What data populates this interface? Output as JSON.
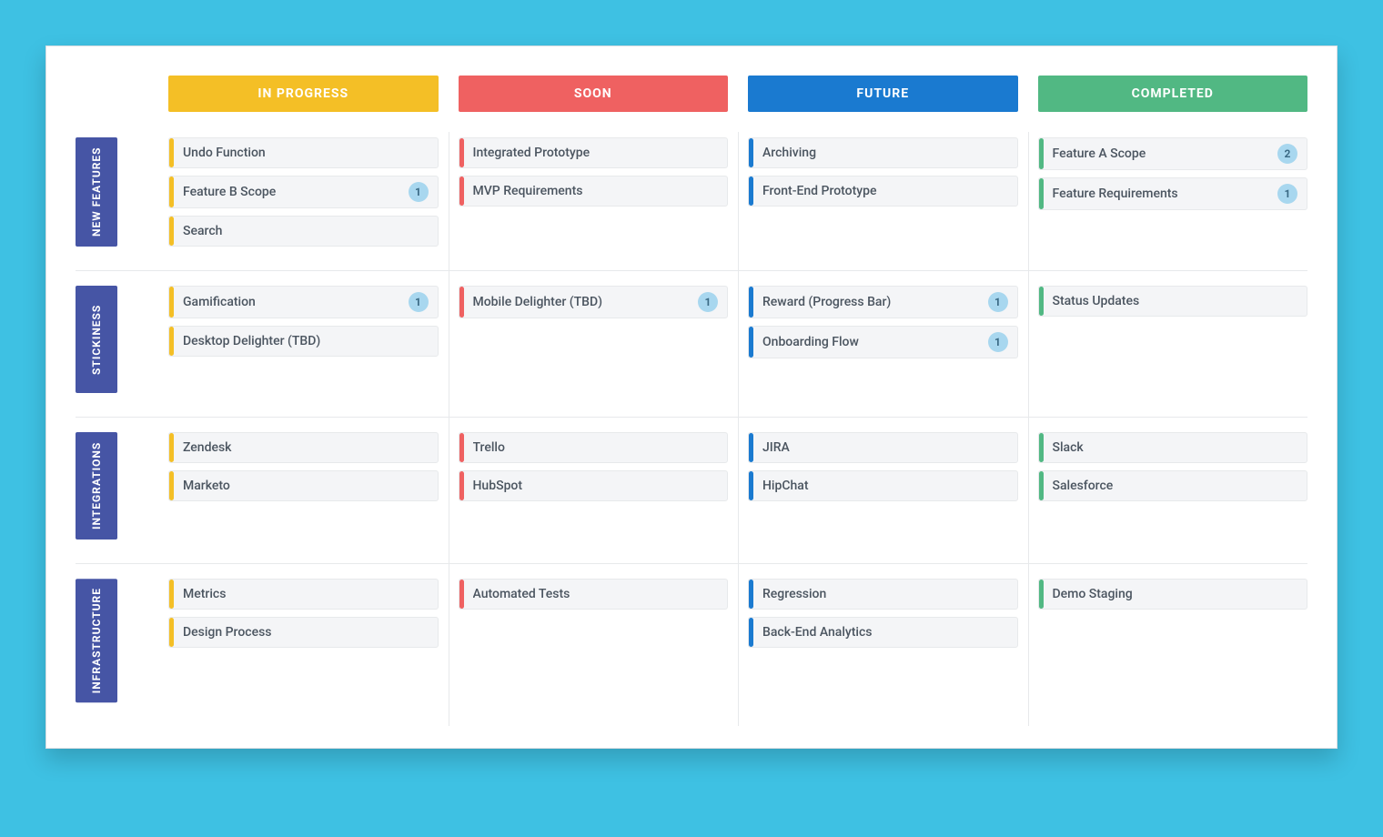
{
  "colors": {
    "in_progress": "#f4bf26",
    "soon": "#ef6161",
    "future": "#1a7ad0",
    "completed": "#51b883",
    "swimlane": "#4655a5",
    "badge_bg": "#a8d7ef"
  },
  "columns": [
    {
      "id": "in_progress",
      "label": "IN PROGRESS",
      "color": "yellow"
    },
    {
      "id": "soon",
      "label": "SOON",
      "color": "red"
    },
    {
      "id": "future",
      "label": "FUTURE",
      "color": "blue"
    },
    {
      "id": "completed",
      "label": "COMPLETED",
      "color": "green"
    }
  ],
  "swimlanes": [
    {
      "id": "new_features",
      "label": "NEW FEATURES",
      "cells": {
        "in_progress": [
          {
            "title": "Undo Function"
          },
          {
            "title": "Feature B Scope",
            "badge": 1
          },
          {
            "title": "Search"
          }
        ],
        "soon": [
          {
            "title": "Integrated Prototype"
          },
          {
            "title": "MVP Requirements"
          }
        ],
        "future": [
          {
            "title": "Archiving"
          },
          {
            "title": "Front-End Prototype"
          }
        ],
        "completed": [
          {
            "title": "Feature A Scope",
            "badge": 2
          },
          {
            "title": "Feature Requirements",
            "badge": 1
          }
        ]
      }
    },
    {
      "id": "stickiness",
      "label": "STICKINESS",
      "cells": {
        "in_progress": [
          {
            "title": "Gamification",
            "badge": 1
          },
          {
            "title": "Desktop Delighter (TBD)"
          }
        ],
        "soon": [
          {
            "title": "Mobile Delighter (TBD)",
            "badge": 1
          }
        ],
        "future": [
          {
            "title": "Reward (Progress Bar)",
            "badge": 1
          },
          {
            "title": "Onboarding Flow",
            "badge": 1
          }
        ],
        "completed": [
          {
            "title": "Status Updates"
          }
        ]
      }
    },
    {
      "id": "integrations",
      "label": "INTEGRATIONS",
      "cells": {
        "in_progress": [
          {
            "title": "Zendesk"
          },
          {
            "title": "Marketo"
          }
        ],
        "soon": [
          {
            "title": "Trello"
          },
          {
            "title": "HubSpot"
          }
        ],
        "future": [
          {
            "title": "JIRA"
          },
          {
            "title": "HipChat"
          }
        ],
        "completed": [
          {
            "title": "Slack"
          },
          {
            "title": "Salesforce"
          }
        ]
      }
    },
    {
      "id": "infrastructure",
      "label": "INFRASTRUCTURE",
      "cells": {
        "in_progress": [
          {
            "title": "Metrics"
          },
          {
            "title": "Design Process"
          }
        ],
        "soon": [
          {
            "title": "Automated Tests"
          }
        ],
        "future": [
          {
            "title": "Regression"
          },
          {
            "title": "Back-End Analytics"
          }
        ],
        "completed": [
          {
            "title": "Demo Staging"
          }
        ]
      }
    }
  ]
}
